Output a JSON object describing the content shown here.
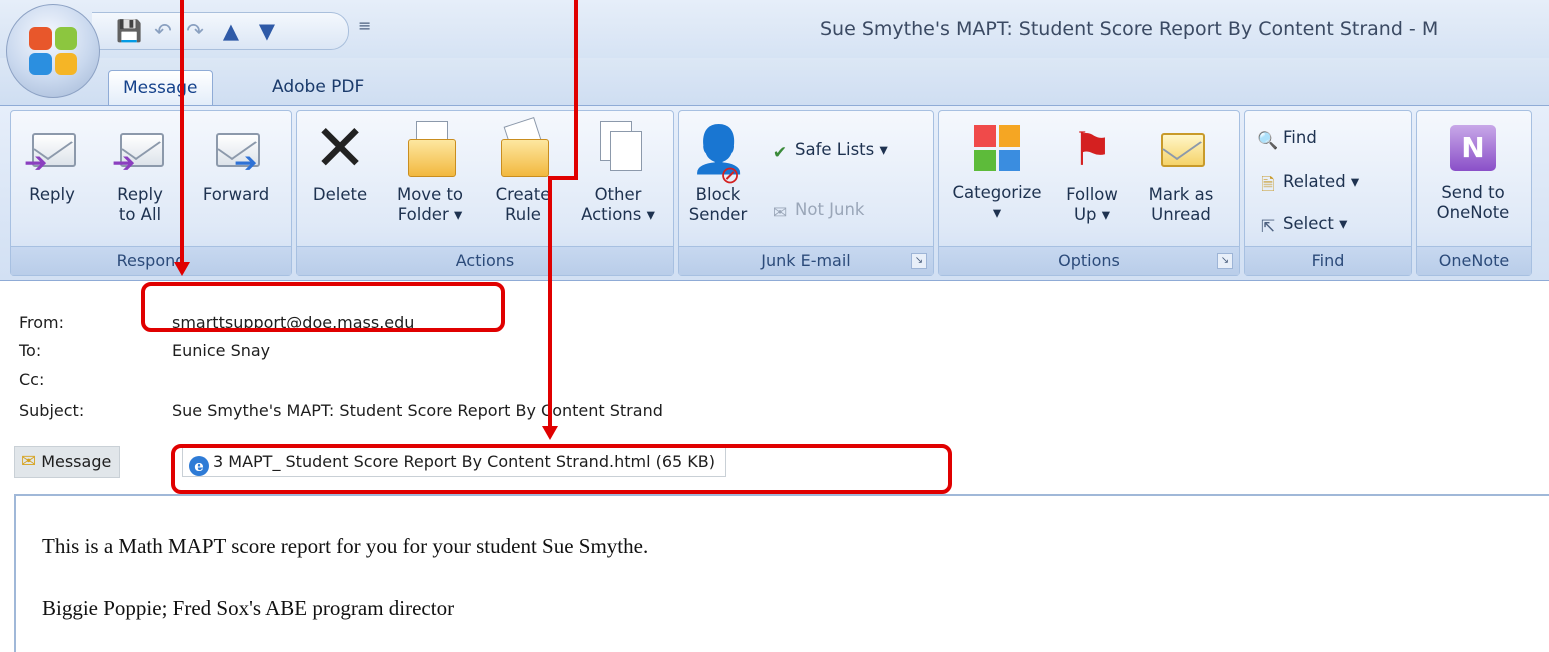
{
  "window": {
    "title": "Sue Smythe's MAPT: Student Score Report By Content Strand - M"
  },
  "tabs": [
    {
      "label": "Message",
      "active": true
    },
    {
      "label": "Adobe PDF",
      "active": false
    }
  ],
  "ribbon": {
    "respond": {
      "label": "Respond",
      "reply": "Reply",
      "reply_all_1": "Reply",
      "reply_all_2": "to All",
      "forward": "Forward"
    },
    "actions": {
      "label": "Actions",
      "delete": "Delete",
      "move_1": "Move to",
      "move_2": "Folder",
      "create_1": "Create",
      "create_2": "Rule",
      "other_1": "Other",
      "other_2": "Actions"
    },
    "junk": {
      "label": "Junk E-mail",
      "block_1": "Block",
      "block_2": "Sender",
      "safe_lists": "Safe Lists",
      "not_junk": "Not Junk"
    },
    "options": {
      "label": "Options",
      "categorize": "Categorize",
      "follow_1": "Follow",
      "follow_2": "Up",
      "mark_1": "Mark as",
      "mark_2": "Unread"
    },
    "find": {
      "label": "Find",
      "find": "Find",
      "related": "Related",
      "select": "Select"
    },
    "onenote": {
      "label": "OneNote",
      "send_1": "Send to",
      "send_2": "OneNote"
    }
  },
  "header": {
    "from_label": "From:",
    "from_value": "smarttsupport@doe.mass.edu",
    "to_label": "To:",
    "to_value": "Eunice Snay",
    "cc_label": "Cc:",
    "cc_value": "",
    "subject_label": "Subject:",
    "subject_value": "Sue Smythe's MAPT: Student Score Report By Content Strand"
  },
  "attachments": {
    "message_tab": "Message",
    "file": "3 MAPT_ Student Score Report By Content Strand.html (65 KB)"
  },
  "body": {
    "line1": "This is a Math MAPT score report for you for your student Sue Smythe.",
    "line2": "Biggie Poppie; Fred Sox's ABE program director"
  },
  "colors": {
    "annotation_red": "#e00000",
    "ribbon_blue": "#d2e0f3"
  },
  "icons": [
    "office-button-icon",
    "save-icon",
    "undo-icon",
    "redo-icon",
    "previous-item-icon",
    "next-item-icon",
    "reply-icon",
    "reply-all-icon",
    "forward-icon",
    "delete-icon",
    "move-to-folder-icon",
    "create-rule-icon",
    "other-actions-icon",
    "block-sender-icon",
    "safe-lists-icon",
    "not-junk-icon",
    "categorize-icon",
    "follow-up-flag-icon",
    "mark-unread-icon",
    "find-icon",
    "related-icon",
    "select-icon",
    "onenote-icon",
    "envelope-icon",
    "internet-explorer-icon"
  ]
}
